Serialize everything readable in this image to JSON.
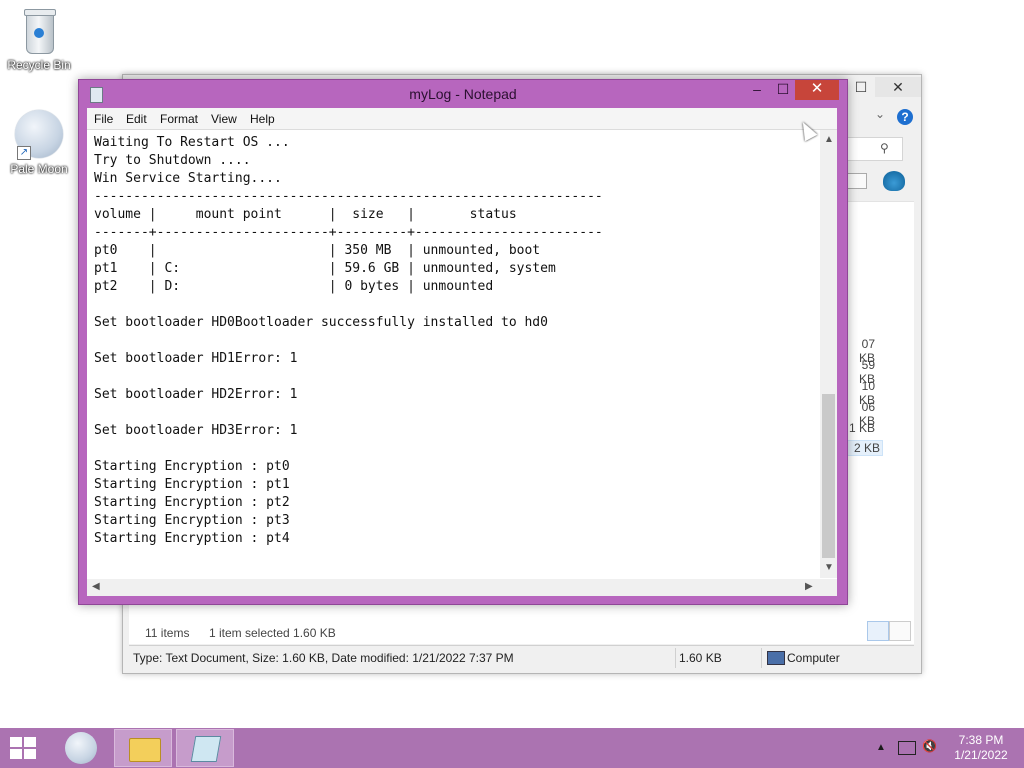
{
  "desktop": {
    "icons": [
      {
        "label": "Recycle Bin"
      },
      {
        "label": "Pale Moon"
      }
    ]
  },
  "explorer": {
    "file_sizes": [
      "07 KB",
      "59 KB",
      "10 KB",
      "06 KB",
      "1 KB",
      "2 KB"
    ],
    "items_count": "11 items",
    "selection": "1 item selected  1.60 KB",
    "status_info": "Type: Text Document, Size: 1.60 KB, Date modified: 1/21/2022 7:37 PM",
    "status_size": "1.60 KB",
    "status_location": "Computer",
    "help_label": "?",
    "close_glyph": "✕",
    "max_glyph": "☐"
  },
  "notepad": {
    "title": "myLog - Notepad",
    "controls": {
      "minimize": "–",
      "maximize": "☐",
      "close": "✕"
    },
    "menu": [
      "File",
      "Edit",
      "Format",
      "View",
      "Help"
    ],
    "content": "Waiting To Restart OS ...\nTry to Shutdown ....\nWin Service Starting....\n-----------------------------------------------------------------\nvolume |     mount point      |  size   |       status\n-------+----------------------+---------+------------------------\npt0    |                      | 350 MB  | unmounted, boot\npt1    | C:                   | 59.6 GB | unmounted, system\npt2    | D:                   | 0 bytes | unmounted\n\nSet bootloader HD0Bootloader successfully installed to hd0\n\nSet bootloader HD1Error: 1\n\nSet bootloader HD2Error: 1\n\nSet bootloader HD3Error: 1\n\nStarting Encryption : pt0\nStarting Encryption : pt1\nStarting Encryption : pt2\nStarting Encryption : pt3\nStarting Encryption : pt4"
  },
  "taskbar": {
    "time": "7:38 PM",
    "date": "1/21/2022"
  },
  "colors": {
    "accent": "#b766be",
    "taskbar": "#ab73b1",
    "close_button": "#c7453a"
  },
  "icons": [
    "recycle-bin-icon",
    "pale-moon-icon",
    "notepad-icon",
    "search-icon",
    "help-icon",
    "windows-logo-icon",
    "file-explorer-icon",
    "network-icon",
    "volume-muted-icon",
    "computer-icon"
  ]
}
